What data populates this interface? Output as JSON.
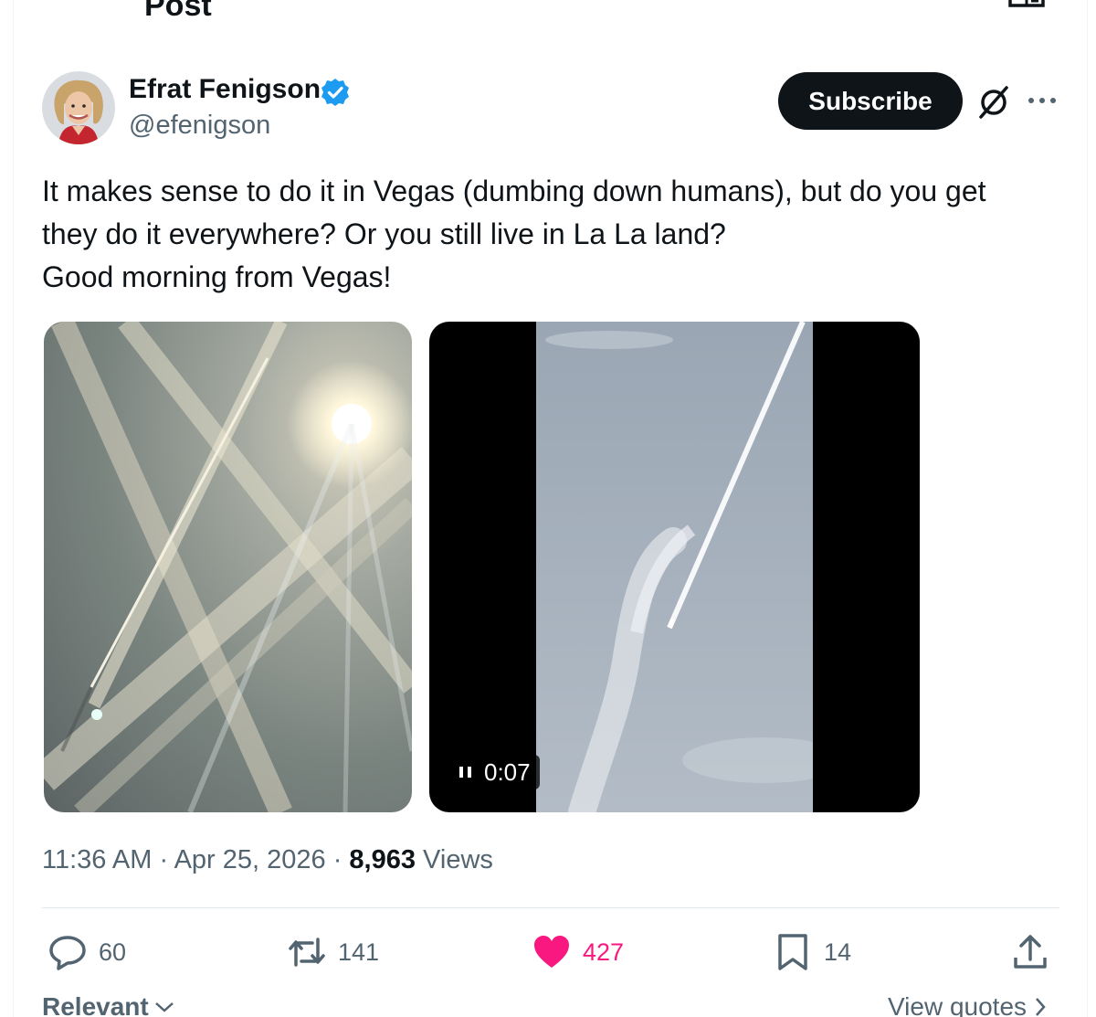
{
  "header": {
    "title": "Post",
    "back_icon": "arrow-left-icon",
    "reader_icon": "reader-icon"
  },
  "author": {
    "name": "Efrat Fenigson",
    "handle": "@efenigson",
    "verified": true,
    "verified_color": "#1d9bf0"
  },
  "actions_top": {
    "subscribe_label": "Subscribe",
    "grok_icon": "grok-icon",
    "more_icon": "more-horizontal-icon"
  },
  "post": {
    "lines": [
      "It makes sense to do it in Vegas (dumbing down humans), but do you get",
      "they do it everywhere? Or you still live in La La land?",
      "Good morning from Vegas!"
    ]
  },
  "media": {
    "photo_icon": "sky-contrails-photo",
    "video": {
      "time": "0:07",
      "pause_icon": "pause-icon"
    }
  },
  "meta": {
    "time": "11:36 AM",
    "separator": " · ",
    "date": "Apr 25, 2026",
    "views_count": "8,963",
    "views_label": " Views"
  },
  "engagement": {
    "replies": "60",
    "reposts": "141",
    "likes": "427",
    "bookmarks": "14",
    "like_color": "#f91880"
  },
  "footer": {
    "sort_label": "Relevant",
    "quotes_label": "View quotes"
  }
}
